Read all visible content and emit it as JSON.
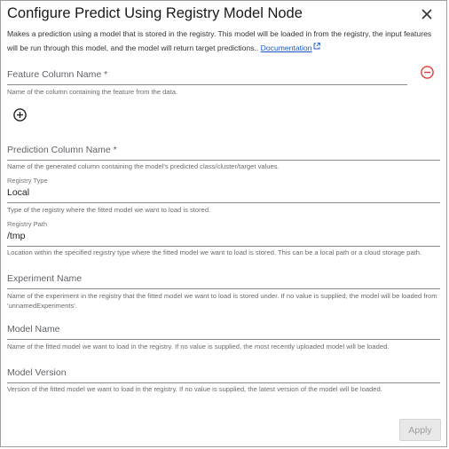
{
  "dialog": {
    "title": "Configure Predict Using Registry Model Node",
    "description": "Makes a prediction using a model that is stored in the registry. This model will be loaded in from the registry, the input features will be run through this model, and the model will return target predictions..",
    "doc_link": "Documentation",
    "apply_label": "Apply"
  },
  "fields": {
    "feature_column": {
      "label": "Feature Column Name *",
      "value": "",
      "help": "Name of the column containing the feature from the data."
    },
    "prediction_column": {
      "label": "Prediction Column Name *",
      "value": "",
      "help": "Name of the generated column containing the model's predicted class/cluster/target values."
    },
    "registry_type": {
      "label": "Registry Type",
      "value": "Local",
      "help": "Type of the registry where the fitted model we want to load is stored."
    },
    "registry_path": {
      "label": "Registry Path",
      "value": "/tmp",
      "help": "Location within the specified registry type where the fitted model we want to load is stored. This can be a local path or a cloud storage path."
    },
    "experiment_name": {
      "label": "Experiment Name",
      "value": "",
      "help": "Name of the experiment in the registry that the fitted model we want to load is stored under. If no value is supplied, the model will be loaded from 'unnamedExperiments'."
    },
    "model_name": {
      "label": "Model Name",
      "value": "",
      "help": "Name of the fitted model we want to load in the registry. If no value is supplied, the most recently uploaded model will be loaded."
    },
    "model_version": {
      "label": "Model Version",
      "value": "",
      "help": "Version of the fitted model we want to load in the registry. If no value is supplied, the latest version of the model will be loaded."
    }
  },
  "icons": {
    "close": "close-icon",
    "remove": "remove-circle-icon",
    "add": "add-circle-icon",
    "external_link": "external-link-icon"
  },
  "colors": {
    "remove_icon": "#e53935",
    "link": "#1a56c7",
    "apply_disabled_bg": "#e8e8e8",
    "apply_disabled_text": "#9e9e9e"
  }
}
